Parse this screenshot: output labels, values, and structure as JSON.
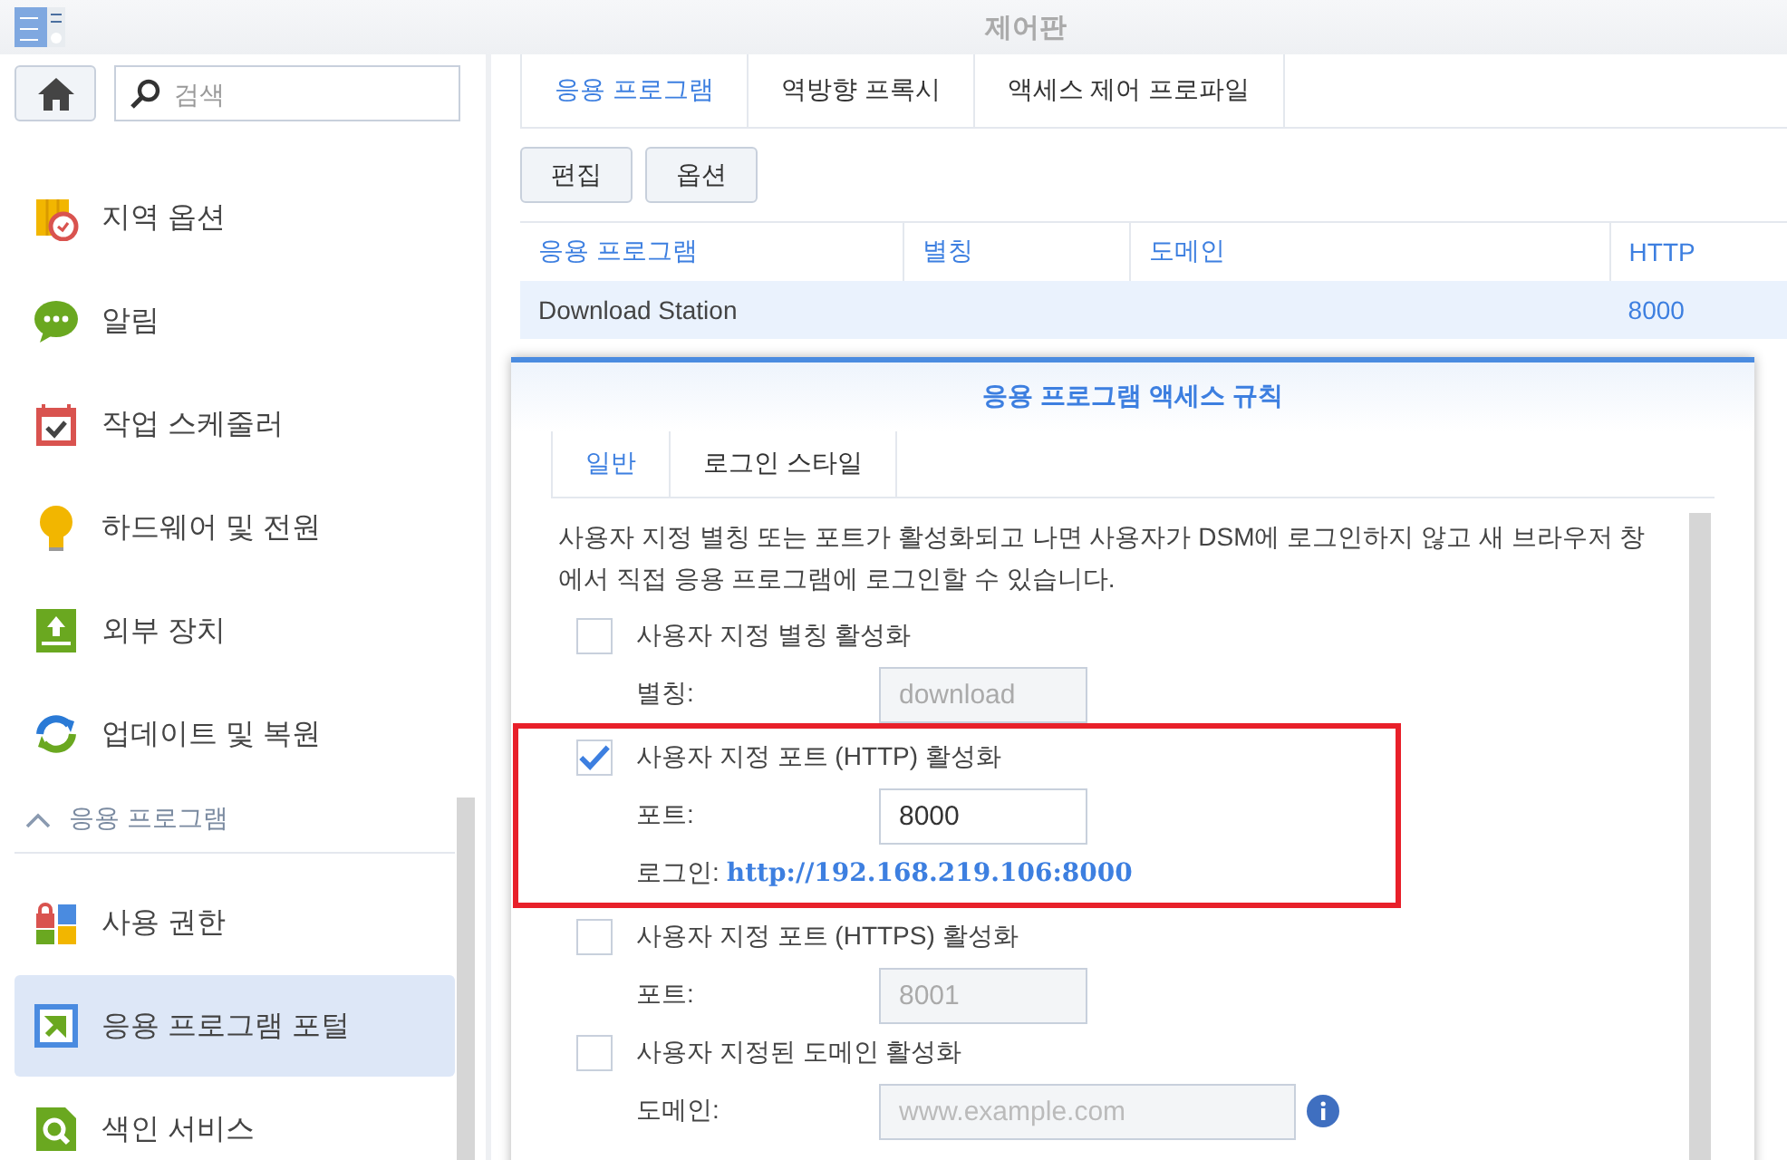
{
  "window": {
    "title": "제어판"
  },
  "sidebar": {
    "search": {
      "placeholder": "검색"
    },
    "items": [
      {
        "kind": "item",
        "label": "지역 옵션",
        "selected": false
      },
      {
        "kind": "item",
        "label": "알림",
        "selected": false
      },
      {
        "kind": "item",
        "label": "작업 스케줄러",
        "selected": false
      },
      {
        "kind": "item",
        "label": "하드웨어 및 전원",
        "selected": false
      },
      {
        "kind": "item",
        "label": "외부 장치",
        "selected": false
      },
      {
        "kind": "item",
        "label": "업데이트 및 복원",
        "selected": false
      },
      {
        "kind": "group",
        "label": "응용 프로그램",
        "expanded": true
      },
      {
        "kind": "item",
        "label": "사용 권한",
        "selected": false
      },
      {
        "kind": "item",
        "label": "응용 프로그램 포털",
        "selected": true
      },
      {
        "kind": "item",
        "label": "색인 서비스",
        "selected": false
      }
    ]
  },
  "tabs": [
    {
      "label": "응용 프로그램",
      "selected": true
    },
    {
      "label": "역방향 프록시",
      "selected": false
    },
    {
      "label": "액세스 제어 프로파일",
      "selected": false
    }
  ],
  "toolbar": {
    "buttons": [
      "편집",
      "옵션"
    ]
  },
  "table": {
    "columns": [
      "응용 프로그램",
      "별칭",
      "도메인",
      "HTTP"
    ],
    "rows": [
      {
        "cells": [
          "Download Station",
          "",
          "",
          "8000"
        ],
        "selected": true
      }
    ]
  },
  "dialog": {
    "title": "응용 프로그램 액세스 규칙",
    "tabs": [
      {
        "label": "일반",
        "selected": true
      },
      {
        "label": "로그인 스타일",
        "selected": false
      }
    ],
    "description": "사용자 지정 별칭 또는 포트가 활성화되고 나면 사용자가 DSM에 로그인하지 않고 새 브라우저 창에서 직접 응용 프로그램에 로그인할 수 있습니다.",
    "sections": [
      {
        "highlighted": false,
        "rows": [
          {
            "kind": "checkbox",
            "label": "사용자 지정 별칭 활성화",
            "checked": false
          },
          {
            "kind": "field",
            "label": "별칭:",
            "value": "download",
            "disabled": true
          }
        ]
      },
      {
        "highlighted": true,
        "rows": [
          {
            "kind": "checkbox",
            "label": "사용자 지정 포트 (HTTP) 활성화",
            "checked": true
          },
          {
            "kind": "field",
            "label": "포트:",
            "value": "8000",
            "disabled": false
          },
          {
            "kind": "link",
            "label": "로그인:",
            "url": "http://192.168.219.106:8000"
          }
        ]
      },
      {
        "highlighted": false,
        "rows": [
          {
            "kind": "checkbox",
            "label": "사용자 지정 포트 (HTTPS) 활성화",
            "checked": false
          },
          {
            "kind": "field",
            "label": "포트:",
            "value": "8001",
            "disabled": true
          },
          {
            "kind": "checkbox",
            "label": "사용자 지정된 도메인 활성화",
            "checked": false
          },
          {
            "kind": "field",
            "label": "도메인:",
            "placeholder": "www.example.com",
            "disabled": true,
            "info": true
          }
        ]
      }
    ]
  }
}
